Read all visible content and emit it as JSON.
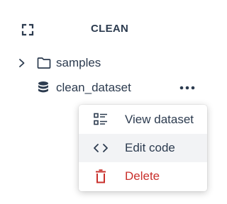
{
  "header": {
    "title": "CLEAN",
    "expand_icon": "expand-icon"
  },
  "tree": {
    "items": [
      {
        "label": "samples",
        "icon": "folder-icon",
        "collapsed": true
      },
      {
        "label": "clean_dataset",
        "icon": "database-icon"
      }
    ],
    "more_icon": "more-horizontal-icon"
  },
  "context_menu": {
    "items": [
      {
        "label": "View dataset",
        "icon": "list-view-icon"
      },
      {
        "label": "Edit code",
        "icon": "code-icon",
        "highlighted": true
      },
      {
        "label": "Delete",
        "icon": "trash-icon",
        "danger": true
      }
    ]
  },
  "colors": {
    "text": "#2c3b4f",
    "danger": "#c9302c",
    "hover_bg": "#f2f3f5"
  }
}
